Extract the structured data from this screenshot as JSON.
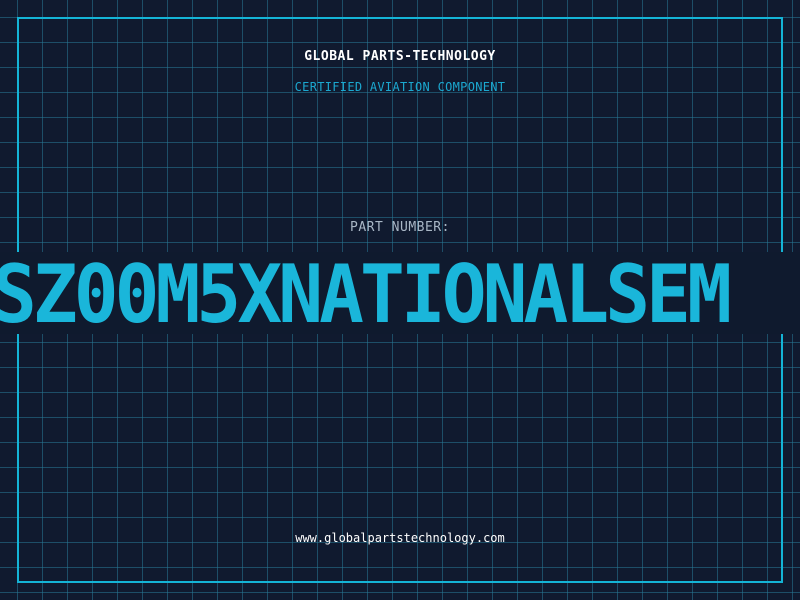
{
  "header": {
    "company_name": "GLOBAL PARTS-TECHNOLOGY",
    "tagline": "CERTIFIED AVIATION COMPONENT"
  },
  "part": {
    "label": "PART NUMBER:",
    "number": "SZ00M5XNATIONALSEM"
  },
  "footer": {
    "website": "www.globalpartstechnology.com"
  },
  "colors": {
    "background": "#101a2f",
    "accent": "#1ab6da",
    "grid": "#28789a",
    "label": "#a9b7c6",
    "heading": "#ffffff"
  }
}
